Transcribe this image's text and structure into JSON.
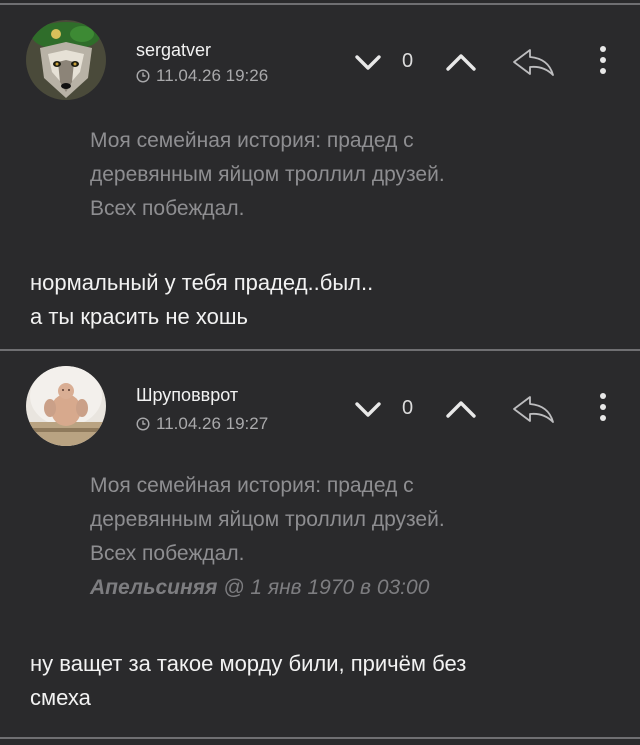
{
  "comments": [
    {
      "username": "sergatver",
      "timestamp": "11.04.26 19:26",
      "score": "0",
      "quote_lines": [
        "Моя семейная история: прадед с",
        "деревянным яйцом троллил друзей.",
        "Всех побеждал."
      ],
      "body_lines": [
        "нормальный у тебя прадед..был..",
        "а ты красить не хошь"
      ],
      "icons": {
        "avatar": "wolf-beret-avatar",
        "clock": "clock-icon",
        "down": "chevron-down-icon",
        "up": "chevron-up-icon",
        "reply": "reply-arrow-icon",
        "menu": "kebab-menu-icon"
      }
    },
    {
      "username": "Шруповврот",
      "timestamp": "11.04.26 19:27",
      "score": "0",
      "quote_lines": [
        "Моя семейная история: прадед с",
        "деревянным яйцом троллил друзей.",
        "Всех побеждал."
      ],
      "quote_author": "Апельсиняя",
      "quote_date": "@ 1 янв 1970 в 03:00",
      "body_lines": [
        "ну ващет за такое морду били, причём без",
        "смеха"
      ],
      "icons": {
        "avatar": "figurine-avatar",
        "clock": "clock-icon",
        "down": "chevron-down-icon",
        "up": "chevron-up-icon",
        "reply": "reply-arrow-icon",
        "menu": "kebab-menu-icon"
      }
    }
  ],
  "colors": {
    "background": "#2a2a2c",
    "divider": "#6f6f72",
    "quote_text": "#8e8e91",
    "meta_text": "#a9a9ab"
  }
}
